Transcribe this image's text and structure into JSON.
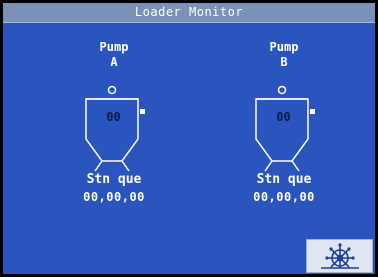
{
  "window": {
    "title": "Loader Monitor"
  },
  "pumps": [
    {
      "line1": "Pump",
      "line2": "A",
      "tank_value": "00",
      "stn_label": "Stn que",
      "stn_value": "00,00,00"
    },
    {
      "line1": "Pump",
      "line2": "B",
      "tank_value": "00",
      "stn_label": "Stn que",
      "stn_value": "00,00,00"
    }
  ],
  "nav_button": {
    "icon": "ship-wheel-icon"
  },
  "colors": {
    "background": "#2a55be",
    "title_bar": "#7b91b7",
    "text": "#ffffff",
    "tank_fill": "#2a55be"
  }
}
